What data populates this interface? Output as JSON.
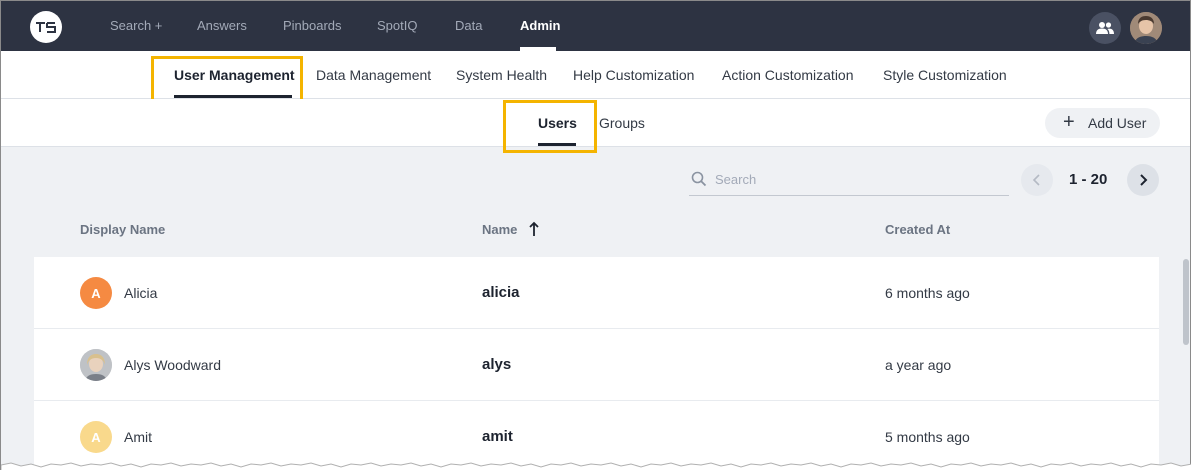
{
  "topnav": {
    "logo_text": "TS",
    "items": [
      {
        "label": "Search +"
      },
      {
        "label": "Answers"
      },
      {
        "label": "Pinboards"
      },
      {
        "label": "SpotIQ"
      },
      {
        "label": "Data"
      },
      {
        "label": "Admin",
        "active": true
      }
    ]
  },
  "admin_tabs": [
    {
      "label": "User Management",
      "active": true
    },
    {
      "label": "Data Management"
    },
    {
      "label": "System Health"
    },
    {
      "label": "Help Customization"
    },
    {
      "label": "Action Customization"
    },
    {
      "label": "Style Customization"
    }
  ],
  "sub_tabs": [
    {
      "label": "Users",
      "active": true
    },
    {
      "label": "Groups"
    }
  ],
  "add_user_label": "Add User",
  "search": {
    "placeholder": "Search"
  },
  "pager": {
    "range": "1 - 20"
  },
  "table": {
    "columns": [
      "Display Name",
      "Name",
      "Created At"
    ],
    "rows": [
      {
        "initial": "A",
        "display_name": "Alicia",
        "name": "alicia",
        "created": "6 months ago"
      },
      {
        "initial": "",
        "display_name": "Alys Woodward",
        "name": "alys",
        "created": "a year ago"
      },
      {
        "initial": "A",
        "display_name": "Amit",
        "name": "amit",
        "created": "5 months ago"
      }
    ]
  },
  "colors": {
    "nav_bg": "#2d3342",
    "highlight": "#f4b400",
    "avatar_orange": "#f58a42",
    "avatar_yellow": "#f9d98c"
  }
}
